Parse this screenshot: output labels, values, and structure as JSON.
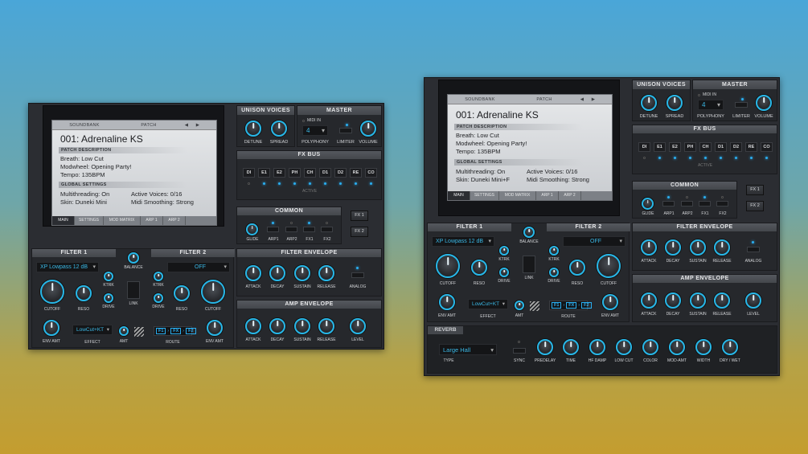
{
  "lcd": {
    "soundbank": "SOUNDBANK",
    "patch": "PATCH",
    "prev": "◀",
    "next": "▶",
    "title": "001: Adrenaline KS",
    "desc_label": "PATCH DESCRIPTION",
    "desc": [
      "Breath: Low Cut",
      "Modwheel: Opening Party!",
      "Tempo: 135BPM"
    ],
    "global_label": "GLOBAL SETTINGS",
    "mt": "Multithreading: On",
    "voices": "Active Voices: 0/16",
    "skin_left": "Skin: Duneki Mini",
    "skin_right": "Skin: Duneki Mini+F",
    "smooth": "Midi Smoothing: Strong",
    "tabs": [
      "MAIN",
      "SETTINGS",
      "MOD MATRIX",
      "ARP 1",
      "ARP 2"
    ]
  },
  "unison": {
    "title": "UNISON VOICES",
    "detune": "DETUNE",
    "spread": "SPREAD"
  },
  "master": {
    "title": "MASTER",
    "midi_in": "MIDI IN",
    "poly_value": "4",
    "polyphony": "POLYPHONY",
    "limiter": "LIMITER",
    "volume": "VOLUME"
  },
  "fxbus": {
    "title": "FX BUS",
    "slots": [
      "DI",
      "E1",
      "E2",
      "PH",
      "CH",
      "D1",
      "D2",
      "RE",
      "CO"
    ],
    "active": "ACTIVE"
  },
  "common": {
    "title": "COMMON",
    "items": [
      "GLIDE",
      "ARP1",
      "ARP2",
      "FX1",
      "FX2"
    ],
    "fx1": "FX 1",
    "fx2": "FX 2"
  },
  "filter1": {
    "title": "FILTER 1",
    "type": "XP Lowpass 12 dB",
    "cutoff": "CUTOFF",
    "reso": "RESO",
    "ktrk": "KTRK",
    "drive": "DRIVE",
    "env_amt": "ENV AMT"
  },
  "filter2": {
    "title": "FILTER 2",
    "type": "OFF",
    "cutoff": "CUTOFF",
    "reso": "RESO",
    "ktrk": "KTRK",
    "drive": "DRIVE",
    "env_amt": "ENV AMT"
  },
  "mid": {
    "balance": "BALANCE",
    "link": "LINK",
    "effect_value": "LowCut+KT",
    "effect": "EFFECT",
    "amt": "AMT",
    "route": "ROUTE",
    "route_items": [
      "F1",
      "FX",
      "F2"
    ]
  },
  "filter_env": {
    "title": "FILTER ENVELOPE",
    "attack": "ATTACK",
    "decay": "DECAY",
    "sustain": "SUSTAIN",
    "release": "RELEASE",
    "analog": "ANALOG"
  },
  "amp_env": {
    "title": "AMP ENVELOPE",
    "attack": "ATTACK",
    "decay": "DECAY",
    "sustain": "SUSTAIN",
    "release": "RELEASE",
    "level": "LEVEL"
  },
  "reverb": {
    "title": "REVERB",
    "type_value": "Large Hall",
    "type": "TYPE",
    "sync": "SYNC",
    "knobs": [
      "PREDELAY",
      "TIME",
      "HF DAMP",
      "LOW CUT",
      "COLOR",
      "MOD-AMT",
      "WIDTH",
      "DRY / WET"
    ]
  },
  "colors": {
    "accent": "#27b7e8",
    "panel": "#2b2d32"
  }
}
